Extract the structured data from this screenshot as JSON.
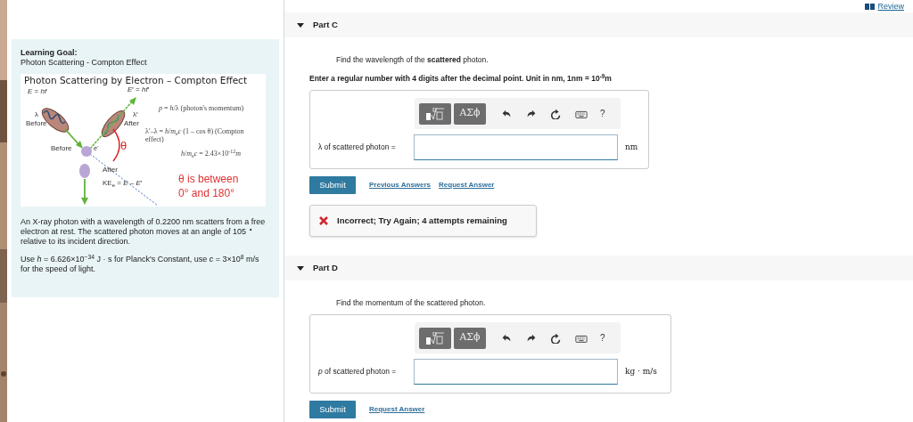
{
  "review_link": "Review",
  "learning_goal": {
    "heading": "Learning Goal:",
    "subtitle": "Photon Scattering - Compton Effect",
    "figure": {
      "title": "Photon Scattering by Electron – Compton Effect",
      "labels": [
        {
          "text": "*E* = *hf*",
          "kind": "label"
        },
        {
          "text": "*E*′ = *hf*′",
          "kind": "label"
        },
        {
          "text": "λ",
          "kind": "label"
        },
        {
          "text": "Before",
          "kind": "label"
        },
        {
          "text": "λ′",
          "kind": "label"
        },
        {
          "text": "After",
          "kind": "label"
        },
        {
          "text": "Before",
          "kind": "label"
        },
        {
          "text": "*e*$^{-}$",
          "kind": "label"
        },
        {
          "text": "After",
          "kind": "label"
        },
        {
          "text": "KE$_{e}$ = *E* – *E*′",
          "kind": "label"
        },
        {
          "text": "*p* = *h*/λ (photon's momentum)",
          "kind": "formula"
        },
        {
          "text": "λ′–λ = *h*/*m*$_{e}$*c* (1 – cos θ) (Compton effect)",
          "kind": "formula"
        },
        {
          "text": "*h*/*m*$_{e}$*c* = 2.43×10$^{-12}$*m*",
          "kind": "formula"
        },
        {
          "text": "θ",
          "kind": "angle"
        },
        {
          "text": "θ is between",
          "kind": "note"
        },
        {
          "text": "0° and 180°",
          "kind": "note"
        }
      ]
    },
    "paragraphs": [
      "An X-ray photon with a wavelength of 0.2200 nm scatters from a free electron at rest. The scattered photon moves at an angle of 105 $^{∘}$ relative to its incident direction.",
      "Use *h* = 6.626×10$^{−34}$ J · s for Planck's Constant, use *c* = 3×10$^{8}$ m/s for the speed of light."
    ]
  },
  "parts": [
    {
      "title": "Part C",
      "expanded": true,
      "prompt": "Find the wavelength of the **scattered** photon.",
      "instruction": "Enter a regular number with 4 digits after the decimal point. Unit in nm, 1nm = 10$^{-9}$m",
      "symbols_button": "ΑΣϕ",
      "help_button": "?",
      "answer_label": "λ of scattered photon =",
      "unit": "nm",
      "buttons": [
        {
          "label": "Submit",
          "kind": "primary"
        },
        {
          "label": "Previous Answers",
          "kind": "link"
        },
        {
          "label": "Request Answer",
          "kind": "link"
        }
      ],
      "feedback": "Incorrect; Try Again; 4 attempts remaining"
    },
    {
      "title": "Part D",
      "expanded": true,
      "prompt": "Find the momentum of the scattered photon.",
      "symbols_button": "ΑΣϕ",
      "help_button": "?",
      "answer_label": "*p* of scattered photon =",
      "unit": "kg · m/s",
      "buttons": [
        {
          "label": "Submit",
          "kind": "primary"
        },
        {
          "label": "Request Answer",
          "kind": "link"
        }
      ]
    }
  ]
}
